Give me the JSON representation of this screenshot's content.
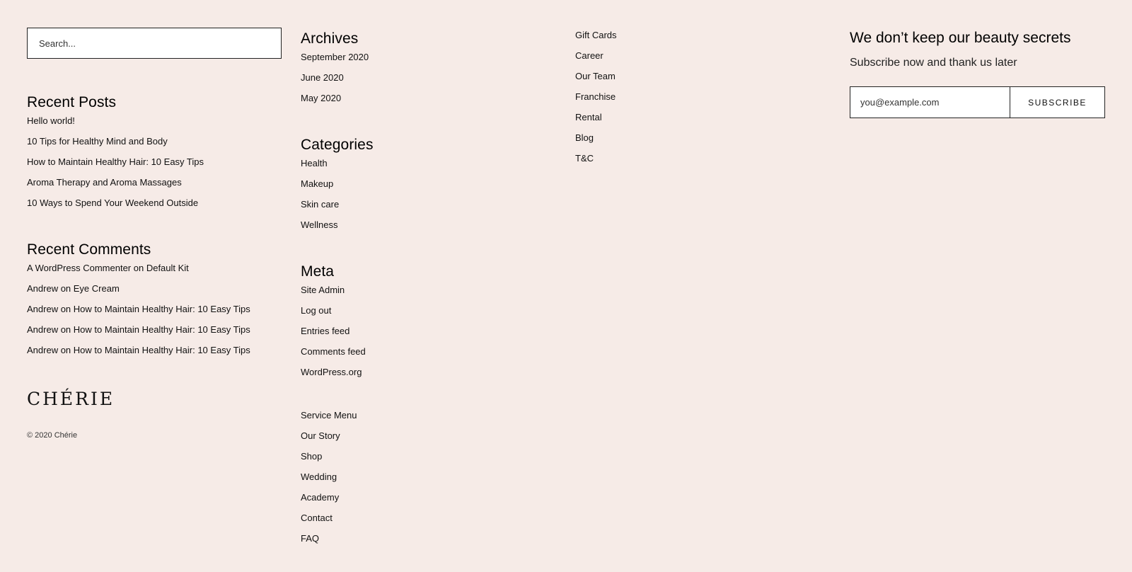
{
  "search": {
    "placeholder": "Search..."
  },
  "recent_posts": {
    "title": "Recent Posts",
    "items": [
      "Hello world!",
      "10 Tips for Healthy Mind and Body",
      "How to Maintain Healthy Hair: 10 Easy Tips",
      "Aroma Therapy and Aroma Massages",
      "10 Ways to Spend Your Weekend Outside"
    ]
  },
  "recent_comments": {
    "title": "Recent Comments",
    "items": [
      "A WordPress Commenter on Default Kit",
      "Andrew on Eye Cream",
      "Andrew on How to Maintain Healthy Hair: 10 Easy Tips",
      "Andrew on How to Maintain Healthy Hair: 10 Easy Tips",
      "Andrew on How to Maintain Healthy Hair: 10 Easy Tips"
    ]
  },
  "brand": {
    "logo": "CHÉRIE",
    "copyright": "© 2020 Chérie"
  },
  "archives": {
    "title": "Archives",
    "items": [
      "September 2020",
      "June 2020",
      "May 2020"
    ]
  },
  "categories": {
    "title": "Categories",
    "items": [
      "Health",
      "Makeup",
      "Skin care",
      "Wellness"
    ]
  },
  "meta": {
    "title": "Meta",
    "items": [
      "Site Admin",
      "Log out",
      "Entries feed",
      "Comments feed",
      "WordPress.org"
    ]
  },
  "service_menu": {
    "items": [
      "Service Menu",
      "Our Story",
      "Shop",
      "Wedding",
      "Academy",
      "Contact",
      "FAQ"
    ]
  },
  "company_menu": {
    "items": [
      "Gift Cards",
      "Career",
      "Our Team",
      "Franchise",
      "Rental",
      "Blog",
      "T&C"
    ]
  },
  "newsletter": {
    "title": "We don’t keep our beauty secrets",
    "subtitle": "Subscribe now and thank us later",
    "email_placeholder": "you@example.com",
    "button_label": "SUBSCRIBE"
  }
}
